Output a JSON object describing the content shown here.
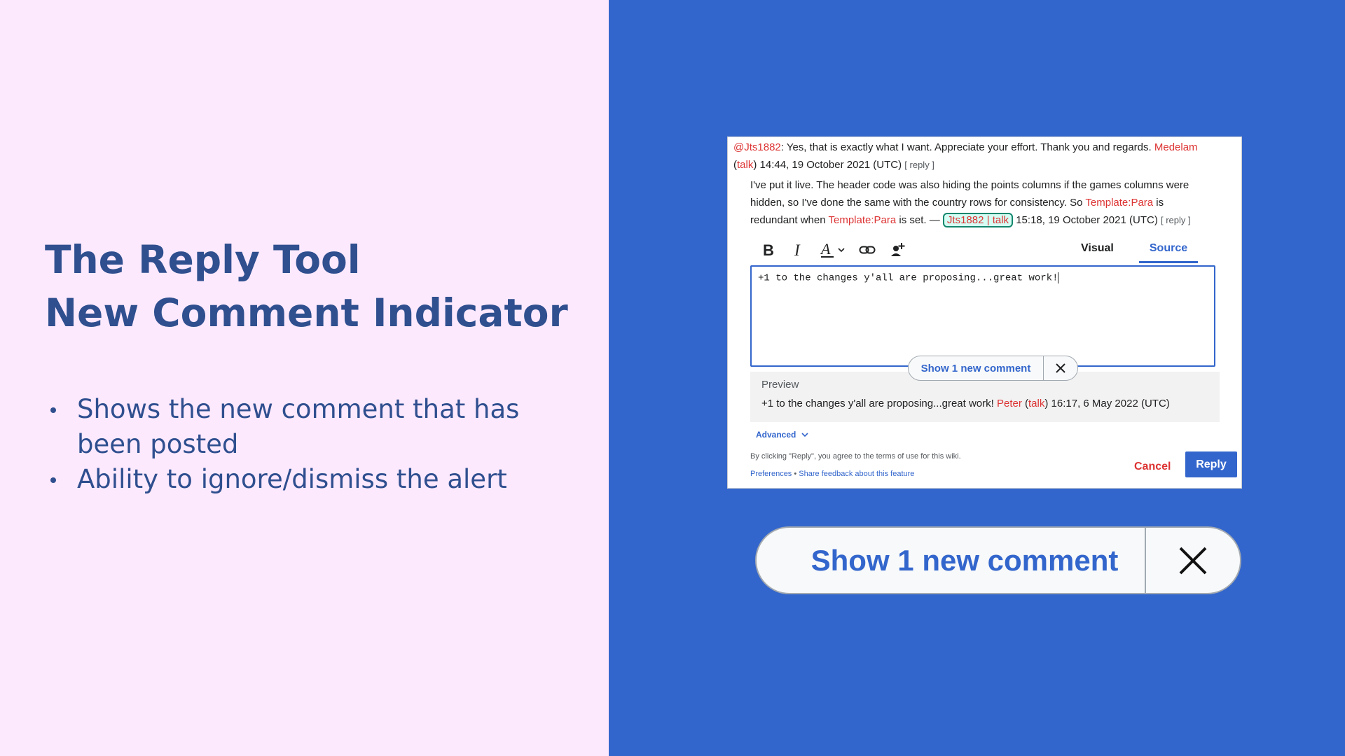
{
  "slide": {
    "title_line1": "The Reply Tool",
    "title_line2": "New Comment Indicator",
    "bullets": [
      "Shows the new comment that has been posted",
      "Ability to ignore/dismiss the alert"
    ]
  },
  "thread": {
    "c1_mention": "@Jts1882",
    "c1_text": ": Yes, that is exactly what I want. Appreciate your effort. Thank you and regards.",
    "c1_author": "Medelam",
    "c1_talk": "talk",
    "c1_time": "14:44, 19 October 2021 (UTC)",
    "c1_reply": "[ reply ]",
    "c2_line1": "I've put it live. The header code was also hiding the points columns if the games columns were",
    "c2_line2a": "hidden, so I've done the same with the country rows for consistency. So",
    "c2_template1": "Template:Para",
    "c2_line2b": "is",
    "c2_line3a": "redundant when",
    "c2_template2": "Template:Para",
    "c2_line3b": "is set. —",
    "c2_user": "Jts1882 | talk",
    "c2_time": "15:18, 19 October 2021 (UTC)",
    "c2_reply": "[ reply ]"
  },
  "toolbar": {
    "bold_icon": "bold-icon",
    "italic_icon": "italic-icon",
    "style_icon": "text-style-icon",
    "link_icon": "link-icon",
    "mention_icon": "add-user-icon",
    "tab_visual": "Visual",
    "tab_source": "Source",
    "active_tab": "Source"
  },
  "editor": {
    "value": "+1 to the changes y'all are proposing...great work!"
  },
  "indicator": {
    "label": "Show 1 new comment",
    "dismiss_icon": "close-icon"
  },
  "preview": {
    "heading": "Preview",
    "text": "+1 to the changes y'all are proposing...great work!",
    "author": "Peter",
    "talk": "talk",
    "time": "16:17, 6 May 2022 (UTC)"
  },
  "footer": {
    "advanced": "Advanced",
    "terms": "By clicking \"Reply\", you agree to the terms of use for this wiki.",
    "preferences": "Preferences",
    "separator": "•",
    "feedback": "Share feedback about this feature",
    "cancel": "Cancel",
    "reply": "Reply"
  },
  "colors": {
    "left_bg": "#fde9fd",
    "right_bg": "#3366cc",
    "title": "#2f4f8f",
    "link_red": "#dd3333",
    "accent": "#3366cc"
  }
}
